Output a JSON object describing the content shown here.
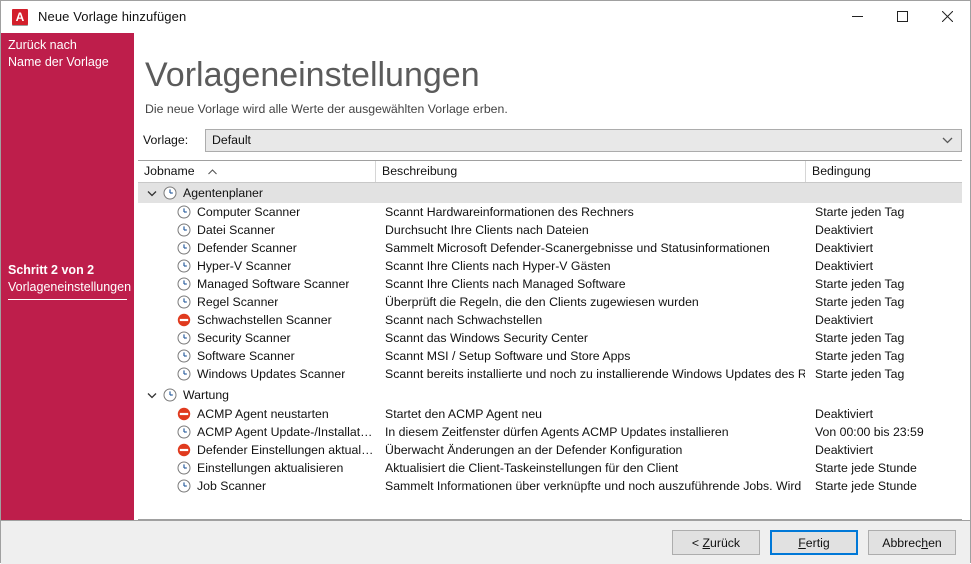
{
  "window": {
    "title": "Neue Vorlage hinzufügen",
    "app_icon": "acmp-logo-icon",
    "icon_letter": "A",
    "minimize_label": "Minimieren",
    "maximize_label": "Maximieren",
    "close_label": "Schließen",
    "accent_red": "#be1e4b",
    "focus_blue": "#0078d7"
  },
  "sidebar": {
    "back_line1": "Zurück nach",
    "back_line2": "Name der Vorlage",
    "step_line1": "Schritt 2 von 2",
    "step_line2": "Vorlageneinstellungen"
  },
  "header": {
    "title": "Vorlageneinstellungen",
    "subtitle": "Die neue Vorlage wird alle Werte der ausgewählten Vorlage erben."
  },
  "template_selector": {
    "label": "Vorlage:",
    "value": "Default",
    "options": [
      "Default"
    ]
  },
  "grid": {
    "columns": [
      {
        "key": "jobname",
        "label": "Jobname",
        "sorted": true,
        "sort_dir": "asc"
      },
      {
        "key": "beschreibung",
        "label": "Beschreibung"
      },
      {
        "key": "bedingung",
        "label": "Bedingung"
      }
    ],
    "groups": [
      {
        "name": "Agentenplaner",
        "icon": "clock-icon",
        "expanded": true,
        "selected": true,
        "rows": [
          {
            "jobname": "Computer Scanner",
            "icon": "clock-icon",
            "beschreibung": "Scannt Hardwareinformationen des Rechners",
            "bedingung": "Starte jeden Tag"
          },
          {
            "jobname": "Datei Scanner",
            "icon": "clock-icon",
            "beschreibung": "Durchsucht Ihre Clients nach Dateien",
            "bedingung": "Deaktiviert"
          },
          {
            "jobname": "Defender Scanner",
            "icon": "clock-icon",
            "beschreibung": "Sammelt Microsoft Defender-Scanergebnisse und Statusinformationen",
            "bedingung": "Deaktiviert"
          },
          {
            "jobname": "Hyper-V Scanner",
            "icon": "clock-icon",
            "beschreibung": "Scannt Ihre Clients nach Hyper-V Gästen",
            "bedingung": "Deaktiviert"
          },
          {
            "jobname": "Managed Software Scanner",
            "icon": "clock-icon",
            "beschreibung": "Scannt Ihre Clients nach Managed Software",
            "bedingung": "Starte jeden Tag"
          },
          {
            "jobname": "Regel Scanner",
            "icon": "clock-icon",
            "beschreibung": "Überprüft die Regeln, die den Clients zugewiesen wurden",
            "bedingung": "Starte jeden Tag"
          },
          {
            "jobname": "Schwachstellen Scanner",
            "icon": "disabled-icon",
            "beschreibung": "Scannt nach Schwachstellen",
            "bedingung": "Deaktiviert"
          },
          {
            "jobname": "Security Scanner",
            "icon": "clock-icon",
            "beschreibung": "Scannt das Windows Security Center",
            "bedingung": "Starte jeden Tag"
          },
          {
            "jobname": "Software Scanner",
            "icon": "clock-icon",
            "beschreibung": "Scannt MSI / Setup Software und Store Apps",
            "bedingung": "Starte jeden Tag"
          },
          {
            "jobname": "Windows Updates Scanner",
            "icon": "clock-icon",
            "beschreibung": "Scannt bereits installierte und noch zu installierende Windows Updates des Rechners",
            "bedingung": "Starte jeden Tag"
          }
        ]
      },
      {
        "name": "Wartung",
        "icon": "clock-icon",
        "expanded": true,
        "selected": false,
        "rows": [
          {
            "jobname": "ACMP Agent neustarten",
            "icon": "disabled-icon",
            "beschreibung": "Startet den ACMP Agent neu",
            "bedingung": "Deaktiviert"
          },
          {
            "jobname": "ACMP Agent Update-/Installation…",
            "icon": "clock-icon",
            "beschreibung": "In diesem Zeitfenster dürfen Agents ACMP Updates installieren",
            "bedingung": "Von 00:00 bis 23:59"
          },
          {
            "jobname": "Defender Einstellungen aktualisie…",
            "icon": "disabled-icon",
            "beschreibung": "Überwacht Änderungen an der Defender Konfiguration",
            "bedingung": "Deaktiviert"
          },
          {
            "jobname": "Einstellungen aktualisieren",
            "icon": "clock-icon",
            "beschreibung": "Aktualisiert die Client-Taskeinstellungen für den Client",
            "bedingung": "Starte jede Stunde"
          },
          {
            "jobname": "Job Scanner",
            "icon": "clock-icon",
            "beschreibung": "Sammelt Informationen über verknüpfte und noch auszuführende Jobs. Wird auch b…",
            "bedingung": "Starte jede Stunde"
          }
        ]
      }
    ]
  },
  "footer": {
    "back_button": {
      "prefix": "< ",
      "accel": "Z",
      "rest": "urück"
    },
    "finish_button": {
      "accel": "F",
      "rest": "ertig"
    },
    "cancel_button": {
      "pre": "Abbrec",
      "accel": "h",
      "post": "en"
    }
  }
}
